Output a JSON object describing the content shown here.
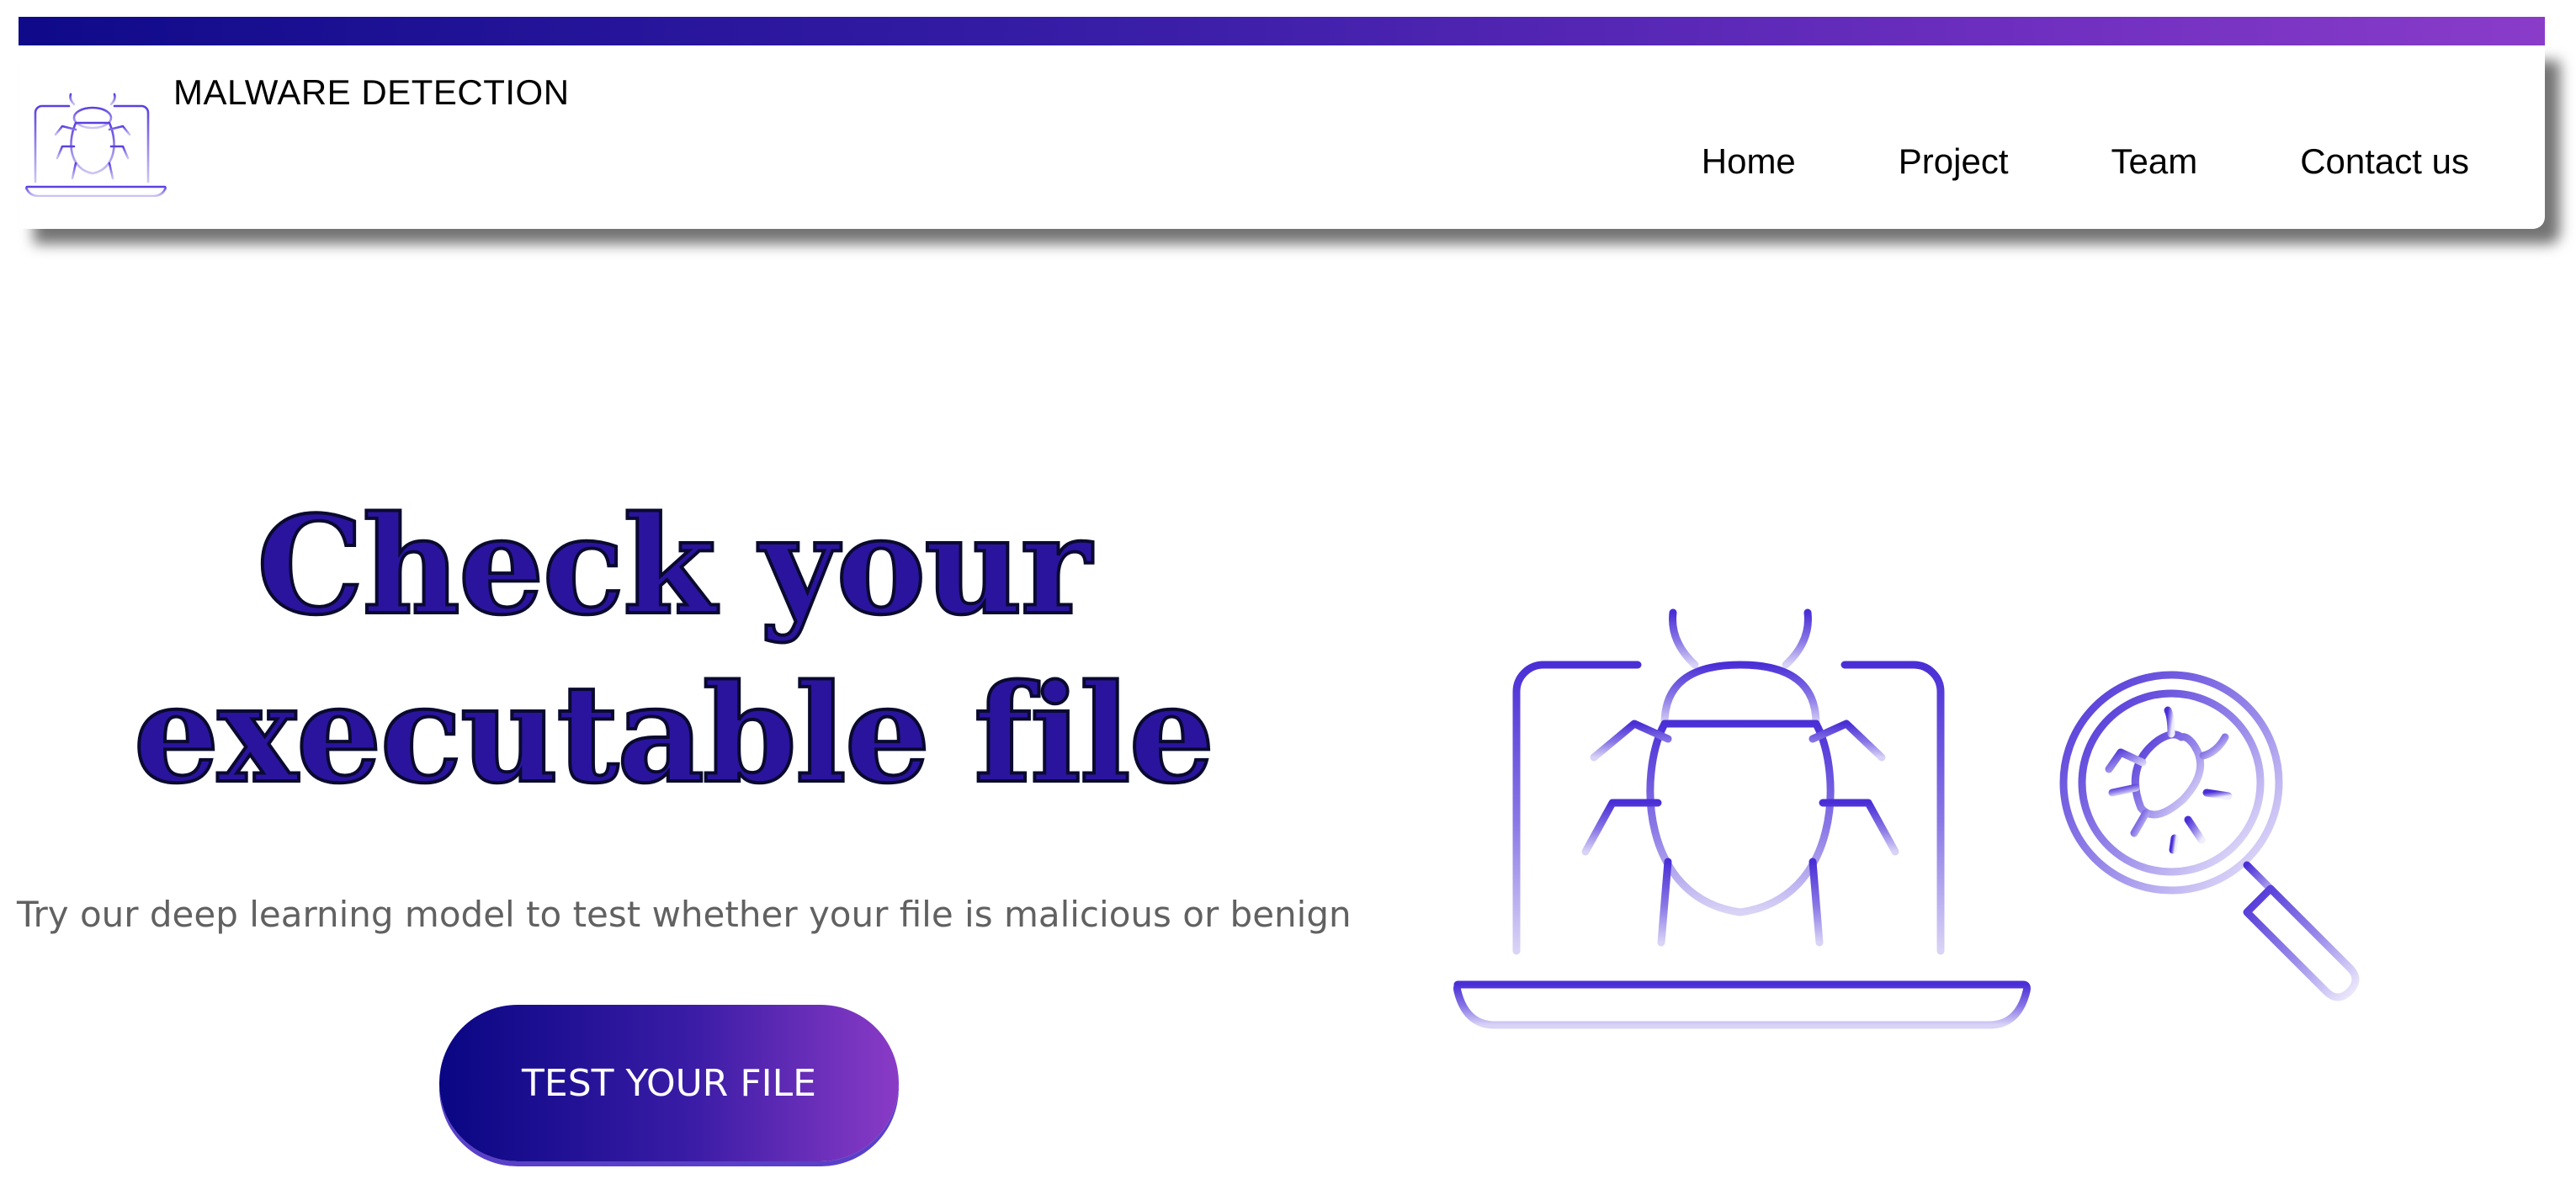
{
  "header": {
    "brand": "MALWARE DETECTION",
    "logo_icon": "laptop-bug-icon",
    "nav": [
      {
        "label": "Home"
      },
      {
        "label": "Project"
      },
      {
        "label": "Team"
      },
      {
        "label": "Contact us"
      }
    ]
  },
  "hero": {
    "title_line1": "Check your",
    "title_line2": "executable file",
    "subtitle": "Try our deep learning model to test whether your file is malicious or benign",
    "cta_label": "TEST YOUR FILE",
    "illustration_icons": [
      "laptop-bug-icon",
      "magnifier-bug-icon"
    ]
  },
  "colors": {
    "brand_dark": "#0f0a8a",
    "brand_purple": "#8a3cc9",
    "title": "#2a149e",
    "illustration": "#5b3fe0",
    "subtitle": "#616161"
  }
}
